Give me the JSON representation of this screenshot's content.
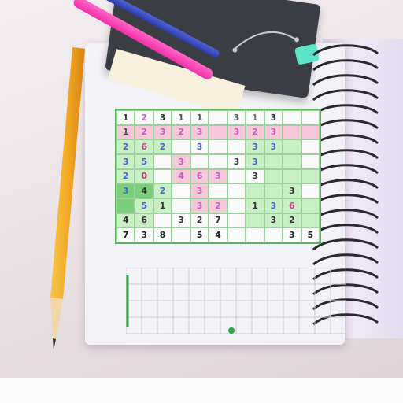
{
  "scene": {
    "colors": {
      "green": "#7ad07a",
      "light_green": "#c9efc4",
      "pink": "#f7c7da",
      "white": "#fbfbfb"
    },
    "puzzle": {
      "rows": [
        [
          {
            "t": "1",
            "c": "#444",
            "b": "#fbfbfb"
          },
          {
            "t": "2",
            "c": "#c060c0",
            "b": "#fbfbfb"
          },
          {
            "t": "3",
            "c": "#333",
            "b": "#fbfbfb"
          },
          {
            "t": "1",
            "c": "#555",
            "b": "#fbfbfb"
          },
          {
            "t": "1",
            "c": "#555",
            "b": "#fbfbfb"
          },
          {
            "t": "",
            "c": "#333",
            "b": "#fbfbfb"
          },
          {
            "t": "3",
            "c": "#555",
            "b": "#fbfbfb"
          },
          {
            "t": "1",
            "c": "#777",
            "b": "#fbfbfb"
          },
          {
            "t": "3",
            "c": "#333",
            "b": "#fbfbfb"
          },
          {
            "t": "",
            "c": "#333",
            "b": "#fbfbfb"
          },
          {
            "t": "",
            "c": "#333",
            "b": "#fbfbfb"
          }
        ],
        [
          {
            "t": "1",
            "c": "#555",
            "b": "#f7c7da"
          },
          {
            "t": "2",
            "c": "#c060c0",
            "b": "#f7c7da"
          },
          {
            "t": "3",
            "c": "#c060c0",
            "b": "#f7c7da"
          },
          {
            "t": "2",
            "c": "#c060c0",
            "b": "#f7c7da"
          },
          {
            "t": "3",
            "c": "#c060c0",
            "b": "#f7c7da"
          },
          {
            "t": "",
            "c": "#333",
            "b": "#f7c7da"
          },
          {
            "t": "3",
            "c": "#c060c0",
            "b": "#f7c7da"
          },
          {
            "t": "2",
            "c": "#c060c0",
            "b": "#f7c7da"
          },
          {
            "t": "3",
            "c": "#c060c0",
            "b": "#f7c7da"
          },
          {
            "t": "",
            "c": "#333",
            "b": "#f7c7da"
          },
          {
            "t": "",
            "c": "#333",
            "b": "#f7c7da"
          }
        ],
        [
          {
            "t": "2",
            "c": "#4466cc",
            "b": "#c9efc4"
          },
          {
            "t": "6",
            "c": "#d04090",
            "b": "#c9efc4"
          },
          {
            "t": "2",
            "c": "#4466cc",
            "b": "#c9efc4"
          },
          {
            "t": "",
            "c": "#333",
            "b": "#fbfbfb"
          },
          {
            "t": "3",
            "c": "#4466cc",
            "b": "#fbfbfb"
          },
          {
            "t": "",
            "c": "#333",
            "b": "#fbfbfb"
          },
          {
            "t": "",
            "c": "#333",
            "b": "#fbfbfb"
          },
          {
            "t": "3",
            "c": "#4466cc",
            "b": "#c9efc4"
          },
          {
            "t": "3",
            "c": "#4466cc",
            "b": "#c9efc4"
          },
          {
            "t": "",
            "c": "#333",
            "b": "#c9efc4"
          },
          {
            "t": "",
            "c": "#333",
            "b": "#fbfbfb"
          }
        ],
        [
          {
            "t": "3",
            "c": "#4466cc",
            "b": "#c9efc4"
          },
          {
            "t": "5",
            "c": "#4466cc",
            "b": "#c9efc4"
          },
          {
            "t": "",
            "c": "#333",
            "b": "#fbfbfb"
          },
          {
            "t": "3",
            "c": "#c060c0",
            "b": "#f7c7da"
          },
          {
            "t": "",
            "c": "#333",
            "b": "#fbfbfb"
          },
          {
            "t": "",
            "c": "#333",
            "b": "#fbfbfb"
          },
          {
            "t": "3",
            "c": "#333",
            "b": "#fbfbfb"
          },
          {
            "t": "3",
            "c": "#4466cc",
            "b": "#c9efc4"
          },
          {
            "t": "",
            "c": "#3399ff",
            "b": "#c9efc4"
          },
          {
            "t": "",
            "c": "#f0a020",
            "b": "#c9efc4"
          },
          {
            "t": "",
            "c": "#333",
            "b": "#fbfbfb"
          }
        ],
        [
          {
            "t": "2",
            "c": "#4466cc",
            "b": "#c9efc4"
          },
          {
            "t": "0",
            "c": "#d03070",
            "b": "#c9efc4"
          },
          {
            "t": "",
            "c": "#333",
            "b": "#fbfbfb"
          },
          {
            "t": "4",
            "c": "#c060c0",
            "b": "#f7c7da"
          },
          {
            "t": "6",
            "c": "#c060c0",
            "b": "#f7c7da"
          },
          {
            "t": "3",
            "c": "#c060c0",
            "b": "#f7c7da"
          },
          {
            "t": "",
            "c": "#333",
            "b": "#fbfbfb"
          },
          {
            "t": "3",
            "c": "#333",
            "b": "#fbfbfb"
          },
          {
            "t": "",
            "c": "#333",
            "b": "#c9efc4"
          },
          {
            "t": "",
            "c": "#333",
            "b": "#c9efc4"
          },
          {
            "t": "",
            "c": "#333",
            "b": "#c9efc4"
          }
        ],
        [
          {
            "t": "3",
            "c": "#4466cc",
            "b": "#7ad07a"
          },
          {
            "t": "4",
            "c": "#333",
            "b": "#7ad07a"
          },
          {
            "t": "2",
            "c": "#4466cc",
            "b": "#c9efc4"
          },
          {
            "t": "",
            "c": "#333",
            "b": "#fbfbfb"
          },
          {
            "t": "3",
            "c": "#c060c0",
            "b": "#f7c7da"
          },
          {
            "t": "",
            "c": "#f0a020",
            "b": "#fbfbfb"
          },
          {
            "t": "",
            "c": "#333",
            "b": "#fbfbfb"
          },
          {
            "t": "",
            "c": "#333",
            "b": "#c9efc4"
          },
          {
            "t": "",
            "c": "#333",
            "b": "#c9efc4"
          },
          {
            "t": "3",
            "c": "#333",
            "b": "#c9efc4"
          },
          {
            "t": "",
            "c": "#333",
            "b": "#fbfbfb"
          }
        ],
        [
          {
            "t": "",
            "c": "#333",
            "b": "#7ad07a"
          },
          {
            "t": "5",
            "c": "#4466cc",
            "b": "#c9efc4"
          },
          {
            "t": "1",
            "c": "#333",
            "b": "#c9efc4"
          },
          {
            "t": "",
            "c": "#333",
            "b": "#fbfbfb"
          },
          {
            "t": "3",
            "c": "#c060c0",
            "b": "#f7c7da"
          },
          {
            "t": "2",
            "c": "#c060c0",
            "b": "#f7c7da"
          },
          {
            "t": "",
            "c": "#333",
            "b": "#fbfbfb"
          },
          {
            "t": "1",
            "c": "#333",
            "b": "#c9efc4"
          },
          {
            "t": "3",
            "c": "#4466cc",
            "b": "#c9efc4"
          },
          {
            "t": "6",
            "c": "#d04090",
            "b": "#c9efc4"
          },
          {
            "t": "",
            "c": "#333",
            "b": "#c9efc4"
          }
        ],
        [
          {
            "t": "4",
            "c": "#333",
            "b": "#c9efc4"
          },
          {
            "t": "6",
            "c": "#333",
            "b": "#c9efc4"
          },
          {
            "t": "",
            "c": "#333",
            "b": "#fbfbfb"
          },
          {
            "t": "3",
            "c": "#333",
            "b": "#fbfbfb"
          },
          {
            "t": "2",
            "c": "#333",
            "b": "#fbfbfb"
          },
          {
            "t": "7",
            "c": "#333",
            "b": "#fbfbfb"
          },
          {
            "t": "",
            "c": "#333",
            "b": "#fbfbfb"
          },
          {
            "t": "",
            "c": "#333",
            "b": "#c9efc4"
          },
          {
            "t": "3",
            "c": "#333",
            "b": "#c9efc4"
          },
          {
            "t": "2",
            "c": "#333",
            "b": "#c9efc4"
          },
          {
            "t": "",
            "c": "#333",
            "b": "#c9efc4"
          }
        ]
      ],
      "bottom_row": [
        {
          "t": "7",
          "c": "#222"
        },
        {
          "t": "3",
          "c": "#222"
        },
        {
          "t": "8",
          "c": "#222"
        },
        {
          "t": "",
          "c": "#222"
        },
        {
          "t": "5",
          "c": "#222"
        },
        {
          "t": "4",
          "c": "#222"
        },
        {
          "t": "",
          "c": "#222"
        },
        {
          "t": "",
          "c": "#222"
        },
        {
          "t": "",
          "c": "#222"
        },
        {
          "t": "3",
          "c": "#222"
        },
        {
          "t": "5",
          "c": "#222"
        }
      ]
    }
  }
}
